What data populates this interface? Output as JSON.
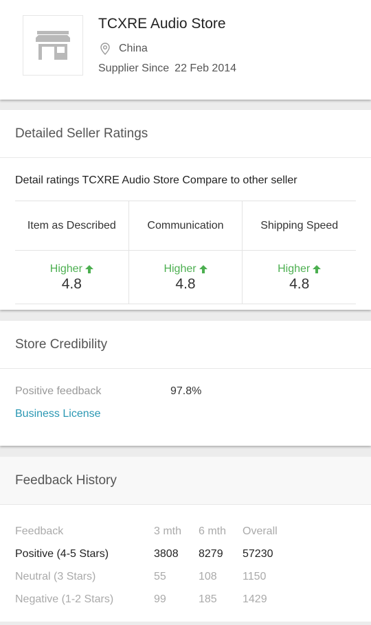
{
  "store": {
    "name": "TCXRE Audio Store",
    "location": "China",
    "since_label": "Supplier Since",
    "since_date": "22 Feb 2014",
    "logo_icon": "store-icon"
  },
  "ratings": {
    "title": "Detailed Seller Ratings",
    "description": "Detail ratings TCXRE Audio Store Compare to other seller",
    "columns": [
      {
        "label": "Item as Described",
        "comparison": "Higher",
        "score": "4.8"
      },
      {
        "label": "Communication",
        "comparison": "Higher",
        "score": "4.8"
      },
      {
        "label": "Shipping Speed",
        "comparison": "Higher",
        "score": "4.8"
      }
    ],
    "higher_color": "#4caf50"
  },
  "credibility": {
    "title": "Store Credibility",
    "positive_label": "Positive feedback",
    "positive_value": "97.8%",
    "license_link": "Business License",
    "link_color": "#2a97b3"
  },
  "feedback_history": {
    "title": "Feedback History",
    "headers": [
      "Feedback",
      "3 mth",
      "6 mth",
      "Overall"
    ],
    "rows": [
      {
        "label": "Positive  (4-5 Stars)",
        "m3": "3808",
        "m6": "8279",
        "overall": "57230"
      },
      {
        "label": "Neutral  (3 Stars)",
        "m3": "55",
        "m6": "108",
        "overall": "1150"
      },
      {
        "label": "Negative  (1-2 Stars)",
        "m3": "99",
        "m6": "185",
        "overall": "1429"
      }
    ]
  }
}
